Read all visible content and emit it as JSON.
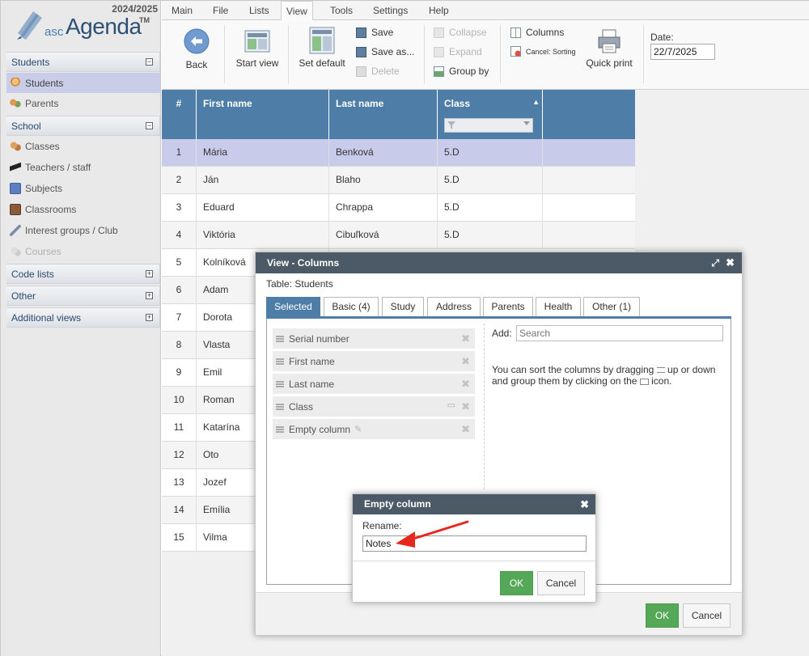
{
  "app": {
    "year": "2024/2025",
    "logo_asc": "asc",
    "logo_agenda": "Agenda",
    "logo_tm": "TM",
    "brand_color": "#2d4f73"
  },
  "sidebar": {
    "sections": [
      {
        "label": "Students",
        "toggle": "−",
        "items": [
          {
            "label": "Students",
            "icon": "student-icon",
            "selected": true
          },
          {
            "label": "Parents",
            "icon": "parents-icon"
          }
        ]
      },
      {
        "label": "School",
        "toggle": "−",
        "items": [
          {
            "label": "Classes",
            "icon": "classes-icon"
          },
          {
            "label": "Teachers / staff",
            "icon": "graduation-cap-icon"
          },
          {
            "label": "Subjects",
            "icon": "book-icon"
          },
          {
            "label": "Classrooms",
            "icon": "door-icon"
          },
          {
            "label": "Interest groups / Club",
            "icon": "tools-icon"
          },
          {
            "label": "Courses",
            "icon": "courses-icon",
            "disabled": true
          }
        ]
      },
      {
        "label": "Code lists",
        "toggle": "+"
      },
      {
        "label": "Other",
        "toggle": "+"
      },
      {
        "label": "Additional views",
        "toggle": "+"
      }
    ]
  },
  "menu": {
    "items": [
      "Main",
      "File",
      "Lists",
      "View",
      "Tools",
      "Settings",
      "Help"
    ],
    "active": "View"
  },
  "ribbon": {
    "back": "Back",
    "start_view": "Start view",
    "set_default": "Set default",
    "save": "Save",
    "save_as": "Save as...",
    "delete": "Delete",
    "collapse": "Collapse",
    "expand": "Expand",
    "group_by": "Group by",
    "columns": "Columns",
    "cancel_sorting": "Cancel: Sorting",
    "quick_print": "Quick print",
    "date_label": "Date:",
    "date_value": "22/7/2025"
  },
  "grid": {
    "headers": [
      "#",
      "First name",
      "Last name",
      "Class"
    ],
    "sort_indicator": "▲",
    "rows": [
      {
        "n": "1",
        "first": "Mária",
        "last": "Benková",
        "class": "5.D"
      },
      {
        "n": "2",
        "first": "Ján",
        "last": "Blaho",
        "class": "5.D"
      },
      {
        "n": "3",
        "first": "Eduard",
        "last": "Chrappa",
        "class": "5.D"
      },
      {
        "n": "4",
        "first": "Viktória",
        "last": "Cibuľková",
        "class": "5.D"
      },
      {
        "n": "5",
        "first": "Kolníková",
        "last": "",
        "class": ""
      },
      {
        "n": "6",
        "first": "Adam",
        "last": "",
        "class": ""
      },
      {
        "n": "7",
        "first": "Dorota",
        "last": "",
        "class": ""
      },
      {
        "n": "8",
        "first": "Vlasta",
        "last": "",
        "class": ""
      },
      {
        "n": "9",
        "first": "Emil",
        "last": "",
        "class": ""
      },
      {
        "n": "10",
        "first": "Roman",
        "last": "",
        "class": ""
      },
      {
        "n": "11",
        "first": "Katarína",
        "last": "",
        "class": ""
      },
      {
        "n": "12",
        "first": "Oto",
        "last": "",
        "class": ""
      },
      {
        "n": "13",
        "first": "Jozef",
        "last": "",
        "class": ""
      },
      {
        "n": "14",
        "first": "Emília",
        "last": "",
        "class": ""
      },
      {
        "n": "15",
        "first": "Vilma",
        "last": "",
        "class": ""
      }
    ]
  },
  "columns_dialog": {
    "title": "View - Columns",
    "table_label": "Table: Students",
    "tabs": [
      "Selected",
      "Basic (4)",
      "Study",
      "Address",
      "Parents",
      "Health",
      "Other (1)"
    ],
    "active_tab": "Selected",
    "selected_columns": [
      "Serial number",
      "First name",
      "Last name",
      "Class",
      "Empty column"
    ],
    "add_label": "Add:",
    "search_placeholder": "Search",
    "help_1": "You can sort the columns by dragging",
    "help_2": "up or down and group them by clicking on the",
    "help_3": "icon.",
    "ok": "OK",
    "cancel": "Cancel"
  },
  "rename_dialog": {
    "title": "Empty column",
    "label": "Rename:",
    "value": "Notes",
    "ok": "OK",
    "cancel": "Cancel",
    "arrow_color": "#e8271f"
  }
}
